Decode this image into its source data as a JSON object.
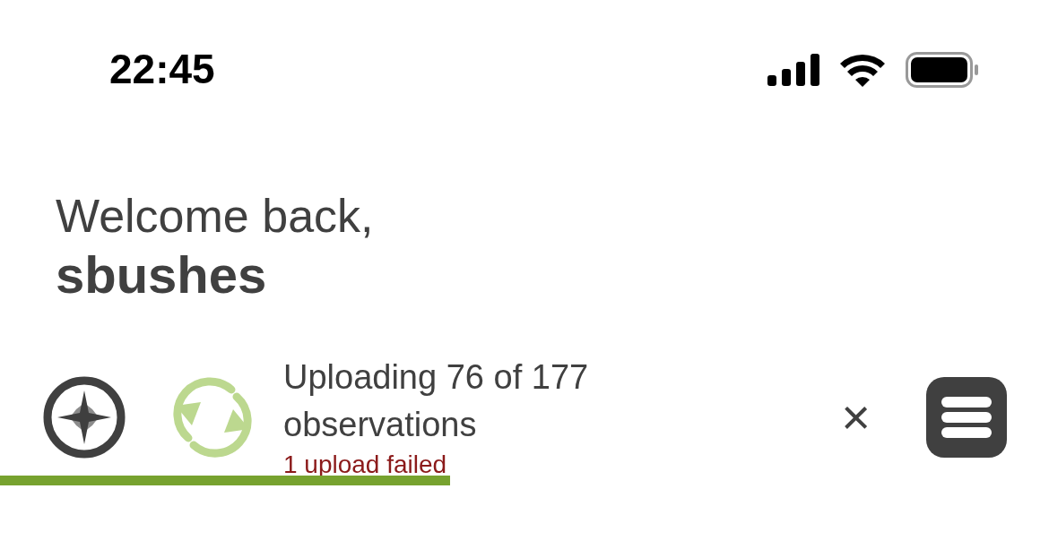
{
  "status_bar": {
    "time": "22:45"
  },
  "greeting": {
    "text": "Welcome back,",
    "username": "sbushes"
  },
  "upload": {
    "title": "Uploading 76 of 177 observations",
    "error": "1 upload failed",
    "close": "×",
    "level": 0.429
  }
}
